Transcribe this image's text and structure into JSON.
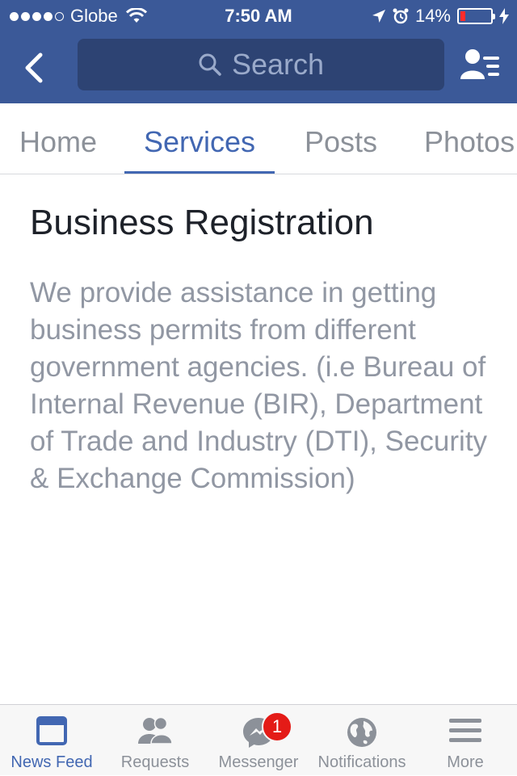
{
  "status_bar": {
    "carrier": "Globe",
    "time": "7:50 AM",
    "battery": "14%",
    "battery_level": 0.14,
    "signal_dots_filled": 4,
    "signal_dots_total": 5
  },
  "nav": {
    "search_placeholder": "Search"
  },
  "tabs": [
    {
      "label": "Home",
      "active": false
    },
    {
      "label": "Services",
      "active": true
    },
    {
      "label": "Posts",
      "active": false
    },
    {
      "label": "Photos",
      "active": false
    }
  ],
  "service": {
    "title": "Business Registration",
    "description": "We provide assistance in getting business permits from different government agencies. (i.e Bureau of Internal Revenue (BIR), Department of Trade and Industry (DTI), Security & Exchange Commission)"
  },
  "bottom_tabs": [
    {
      "label": "News Feed",
      "icon": "news-feed-icon",
      "active": true
    },
    {
      "label": "Requests",
      "icon": "friend-requests-icon",
      "active": false
    },
    {
      "label": "Messenger",
      "icon": "messenger-icon",
      "active": false,
      "badge": "1"
    },
    {
      "label": "Notifications",
      "icon": "globe-icon",
      "active": false
    },
    {
      "label": "More",
      "icon": "menu-icon",
      "active": false
    }
  ],
  "colors": {
    "brand": "#3b5998",
    "accent": "#4267b2",
    "badge": "#e41b17"
  }
}
